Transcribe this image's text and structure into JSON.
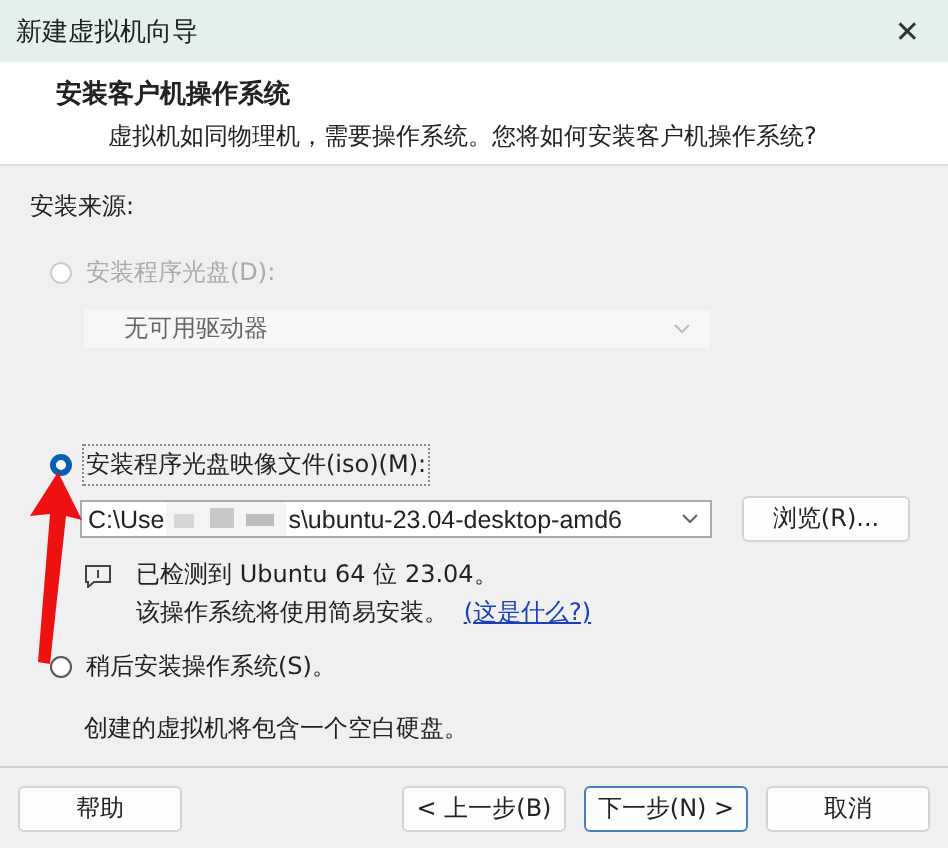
{
  "window": {
    "title": "新建虚拟机向导",
    "close": "✕"
  },
  "header": {
    "title": "安装客户机操作系统",
    "subtitle": "虚拟机如同物理机，需要操作系统。您将如何安装客户机操作系统?"
  },
  "source_label": "安装来源:",
  "options": [
    {
      "kind": "drive",
      "label": "安装程序光盘(D):",
      "selected": false,
      "disabled": true,
      "dropdown": "无可用驱动器"
    },
    {
      "kind": "iso",
      "label": "安装程序光盘映像文件(iso)(M):",
      "selected": true,
      "disabled": false,
      "path_start": "C:\\Use",
      "path_end": "s\\ubuntu-23.04-desktop-amd6",
      "browse": "浏览(R)...",
      "detected": "已检测到 Ubuntu 64 位 23.04。",
      "note": "该操作系统将使用简易安装。",
      "link": "(这是什么?)"
    },
    {
      "kind": "later",
      "label": "稍后安装操作系统(S)。",
      "selected": false,
      "disabled": false,
      "description": "创建的虚拟机将包含一个空白硬盘。"
    }
  ],
  "buttons": [
    {
      "label": "帮助",
      "kind": "help"
    },
    {
      "label": "< 上一步(B)",
      "kind": "back"
    },
    {
      "label": "下一步(N) >",
      "kind": "next",
      "default": true
    },
    {
      "label": "取消",
      "kind": "cancel"
    }
  ]
}
